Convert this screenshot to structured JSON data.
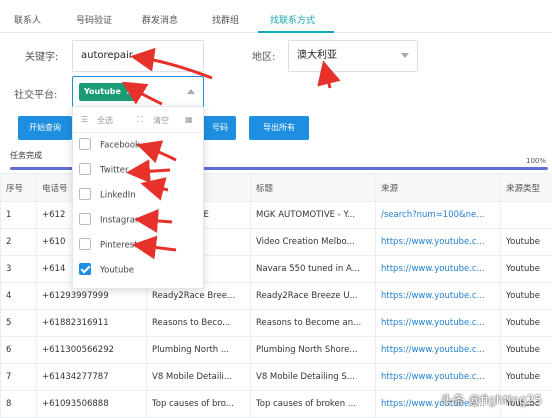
{
  "tabs": [
    "联系人",
    "号码验证",
    "群发消息",
    "找群组",
    "找联系方式"
  ],
  "form": {
    "keyword_label": "关键字:",
    "keyword_value": "autorepair",
    "region_label": "地区:",
    "region_value": "澳大利亚",
    "social_label": "社交平台:",
    "social_tag": "Youtube",
    "social_tag_close": "×"
  },
  "buttons": {
    "start_label": "开始查询",
    "copy_numbers_label": "号码",
    "export_all_label": "导出所有"
  },
  "dropdown": {
    "select_all": "全选",
    "clear": "清空",
    "options": [
      {
        "label": "Facebook",
        "checked": false
      },
      {
        "label": "Twitter",
        "checked": false
      },
      {
        "label": "LinkedIn",
        "checked": false
      },
      {
        "label": "Instagram",
        "checked": false
      },
      {
        "label": "Pinterest",
        "checked": false
      },
      {
        "label": "Youtube",
        "checked": true
      }
    ]
  },
  "progress": {
    "label": "任务完成",
    "percent_text": "100%",
    "value": 1.0
  },
  "table": {
    "headers": [
      "序号",
      "电话号",
      "",
      "标题",
      "来源",
      "来源类型"
    ],
    "rows": [
      [
        "1",
        "+612",
        "AUTOMOTIVE",
        "MGK AUTOMOTIVE - Y...",
        "/search?num=100&ne...",
        ""
      ],
      [
        "2",
        "+610",
        "ion M...",
        "Video Creation Melbo...",
        "https://www.youtube.c...",
        "Youtube"
      ],
      [
        "3",
        "+614",
        "",
        "Navara 550 tuned in A...",
        "https://www.youtube.c...",
        "Youtube"
      ],
      [
        "4",
        "+61293997999",
        "Ready2Race Bree...",
        "Ready2Race Breeze U...",
        "https://www.youtube.c...",
        "Youtube"
      ],
      [
        "5",
        "+61882316911",
        "Reasons to Beco...",
        "Reasons to Become an...",
        "https://www.youtube.c...",
        "Youtube"
      ],
      [
        "6",
        "+611300566292",
        "Plumbing North ...",
        "Plumbing North Shore...",
        "https://www.youtube.c...",
        "Youtube"
      ],
      [
        "7",
        "+61434277787",
        "V8 Mobile Detaili...",
        "V8 Mobile Detailing S...",
        "https://www.youtube.c...",
        "Youtube"
      ],
      [
        "8",
        "+61093506888",
        "Top causes of bro...",
        "Top causes of broken ...",
        "https://www.youtube.c...",
        "Youtube"
      ]
    ]
  },
  "watermark": "头条 @fighting25",
  "colors": {
    "accent": "#16a7b5",
    "button": "#1e8fe0",
    "tag": "#1b9b76",
    "arrow": "#e6322b"
  }
}
